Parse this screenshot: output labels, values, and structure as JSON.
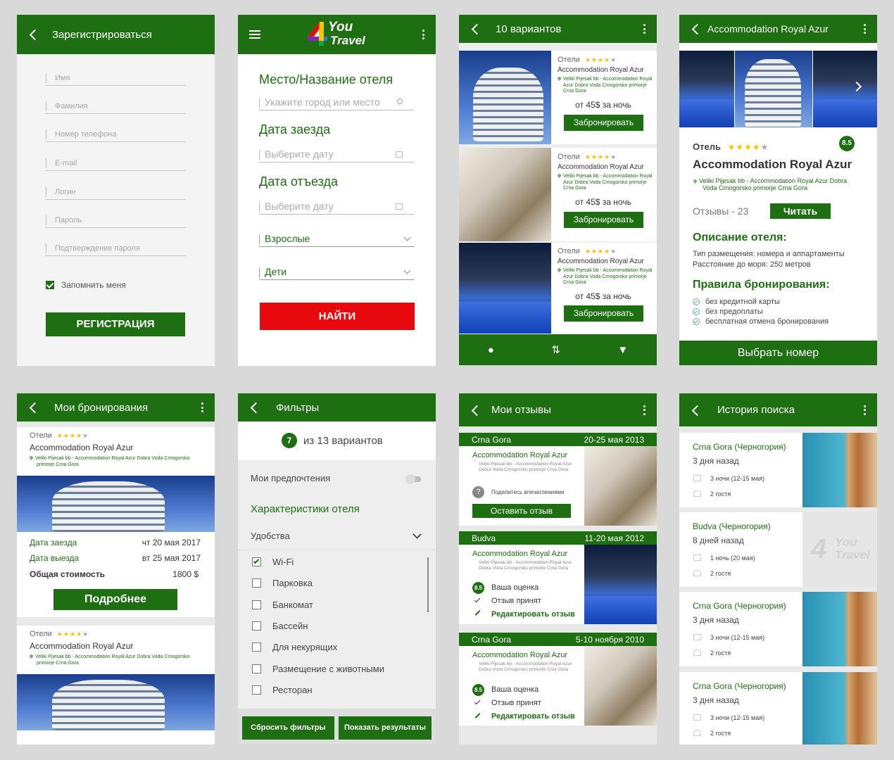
{
  "s1": {
    "title": "Зарегистрироваться",
    "fields": [
      "Имя",
      "Фамилия",
      "Номер телефона",
      "E-mail",
      "Логин",
      "Пароль",
      "Подтверждение пароля"
    ],
    "remember": "Запомнить меня",
    "button": "РЕГИСТРАЦИЯ"
  },
  "s2": {
    "logo": {
      "line1": "You",
      "line2": "Travel",
      "digit": "4"
    },
    "place_label": "Место/Название отеля",
    "place_placeholder": "Укажите город или место",
    "checkin_label": "Дата заезда",
    "checkin_placeholder": "Выберите дату",
    "checkout_label": "Дата отъезда",
    "checkout_placeholder": "Выберите дату",
    "adults": "Взрослые",
    "children": "Дети",
    "button": "НАЙТИ"
  },
  "s3": {
    "title": "10 вариантов",
    "cards": [
      {
        "category": "Отели",
        "name": "Accommodation Royal Azur",
        "address": "Veliki Pijesak bb - Accommodation Royal Azur Dobra Voda Crnogorsko primorje Crna Gora",
        "price": "от 45$ за ночь",
        "button": "Забронировать"
      },
      {
        "category": "Отели",
        "name": "Accommodation Royal Azur",
        "address": "Veliki Pijesak bb - Accommodation Royal Azur Dobra Voda Crnogorsko primorje Crna Gora",
        "price": "от 45$ за ночь",
        "button": "Забронировать"
      },
      {
        "category": "Отели",
        "name": "Accommodation Royal Azur",
        "address": "Veliki Pijesak bb - Accommodation Royal Azur Dobra Voda Crnogorsko primorje Crna Gora",
        "price": "от 45$ за ночь",
        "button": "Забронировать"
      }
    ],
    "nav": [
      "map-pin-icon",
      "sort-icon",
      "filter-icon"
    ]
  },
  "s4": {
    "title": "Accommodation Royal Azur",
    "category": "Отель",
    "score": "8.5",
    "name": "Accommodation Royal Azur",
    "address": "Veliki Pijesak bb - Accommodation Royal Azur Dobra Voda Crnogorsko primorje Crna Gora",
    "reviews": "Отзывы - 23",
    "read": "Читать",
    "desc_label": "Описание отеля:",
    "desc_line1": "Тип размещения: номера и аппартаменты",
    "desc_line2": "Расстояние до моря: 250 метров",
    "rules_label": "Правила бронирования:",
    "rules": [
      "без кредитной карты",
      "без предоплаты",
      "бесплатная отмена бронирования"
    ],
    "button": "Выбрать номер"
  },
  "s5": {
    "title": "Мои бронирования",
    "bookings": [
      {
        "category": "Отели",
        "name": "Accommodation Royal Azur",
        "address": "Veliki Pijesak bb - Accommodation Royal Azur Dobra Voda Crnogorsko primorje Crna Gora",
        "checkin_label": "Дата заезда",
        "checkin": "чт 20 мая 2017",
        "checkout_label": "Дата выезда",
        "checkout": "вт 25 мая 2017",
        "total_label": "Общая стоимость",
        "total": "1800 $",
        "button": "Подробнее"
      },
      {
        "category": "Отели",
        "name": "Accommodation Royal Azur",
        "address": "Veliki Pijesak bb - Accommodation Royal Azur Dobra Voda Crnogorsko primorje Crna Gora"
      }
    ]
  },
  "s6": {
    "title": "Фильтры",
    "count": "7",
    "count_text": "из 13 вариантов",
    "prefs": "Мои предпочтения",
    "chars": "Характеристики отеля",
    "amen": "Удобства",
    "options": [
      {
        "label": "Wi-Fi",
        "checked": true
      },
      {
        "label": "Парковка",
        "checked": false
      },
      {
        "label": "Банкомат",
        "checked": false
      },
      {
        "label": "Бассейн",
        "checked": false
      },
      {
        "label": "Для некурящих",
        "checked": false
      },
      {
        "label": "Размещение с животными",
        "checked": false
      },
      {
        "label": "Ресторан",
        "checked": false
      }
    ],
    "reset": "Сбросить фильтры",
    "show": "Показать результаты"
  },
  "s7": {
    "title": "Мои отзывы",
    "reviews": [
      {
        "place": "Crna Gora",
        "dates": "20-25 мая 2013",
        "name": "Accommodation Royal Azur",
        "address": "Veliki Pijesak bb - Accommodation Royal Azur Dobra Voda Crnogorsko primorje Crna Gora",
        "share": "Поделитесь впечатлениями",
        "button": "Оставить отзыв"
      },
      {
        "place": "Budva",
        "dates": "11-20 мая 2012",
        "name": "Accommodation Royal Azur",
        "address": "Veliki Pijesak bb - Accommodation Royal Azur Dobra Voda Crnogorsko primorje Crna Gora",
        "score": "8.5",
        "score_label": "Ваша оценка",
        "accepted": "Отзыв принят",
        "edit": "Редактировать отзыв"
      },
      {
        "place": "Crna Gora",
        "dates": "5-10 ноября 2010",
        "name": "Accommodation Royal Azur",
        "address": "Veliki Pijesak bb - Accommodation Royal Azur Dobra Voda Crnogorsko primorje Crna Gora",
        "score": "8.5",
        "score_label": "Ваша оценка",
        "accepted": "Отзыв принят",
        "edit": "Редактировать отзыв"
      }
    ]
  },
  "s8": {
    "title": "История поиска",
    "items": [
      {
        "place": "Crna Gora (Черногория)",
        "ago": "3 дня назад",
        "nights": "3 ночи (12-15 мая)",
        "guests": "2 гостя"
      },
      {
        "place": "Budva (Черногория)",
        "ago": "8 дней назад",
        "nights": "1 ночь (20 мая)",
        "guests": "2 гостя"
      },
      {
        "place": "Crna Gora (Черногория)",
        "ago": "3 дня назад",
        "nights": "3 ночи (12-15 мая)",
        "guests": "2 гостя"
      },
      {
        "place": "Crna Gora (Черногория)",
        "ago": "3 дня назад",
        "nights": "3 ночи (12-15 мая)",
        "guests": "2 гостя"
      }
    ]
  },
  "colors": {
    "green": "#1e6e12",
    "red": "#e8090f",
    "star": "#f7c400"
  }
}
